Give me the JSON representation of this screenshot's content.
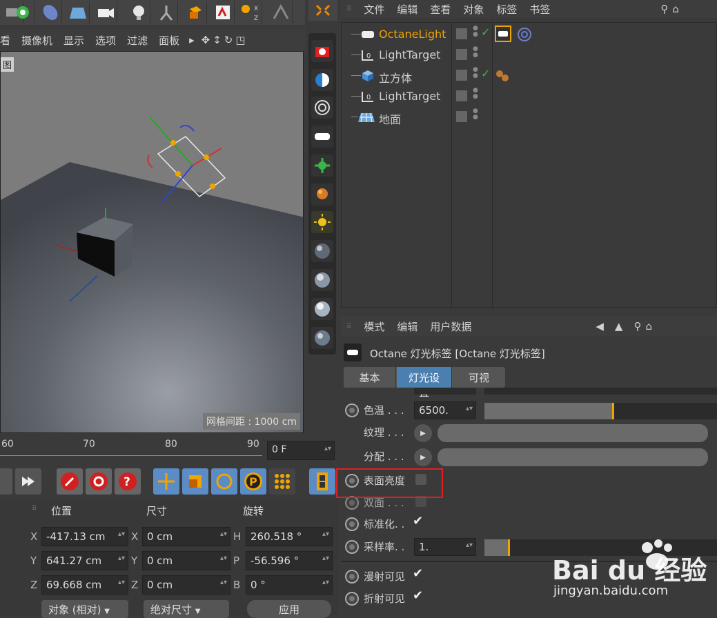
{
  "view_menu": [
    "看",
    "摄像机",
    "显示",
    "选项",
    "过滤",
    "面板"
  ],
  "viewport": {
    "label": "图",
    "grid_label": "网格间距 : 1000 cm"
  },
  "timeline": {
    "ticks": [
      "60",
      "70",
      "80",
      "90"
    ],
    "frame_value": "0 F"
  },
  "coords": {
    "headers": {
      "position": "位置",
      "size": "尺寸",
      "rotation": "旋转"
    },
    "rows": [
      {
        "axis": "X",
        "pos": "-417.13 cm",
        "size_axis": "X",
        "size": "0 cm",
        "rot_axis": "H",
        "rot": "260.518 °"
      },
      {
        "axis": "Y",
        "pos": "641.27 cm",
        "size_axis": "Y",
        "size": "0 cm",
        "rot_axis": "P",
        "rot": "-56.596 °"
      },
      {
        "axis": "Z",
        "pos": "69.668 cm",
        "size_axis": "Z",
        "size": "0 cm",
        "rot_axis": "B",
        "rot": "0 °"
      }
    ],
    "object_mode": "对象 (相对)",
    "size_mode": "绝对尺寸",
    "apply": "应用"
  },
  "object_manager": {
    "menu": [
      "文件",
      "编辑",
      "查看",
      "对象",
      "标签",
      "书签"
    ],
    "objects": [
      {
        "name": "OctaneLight",
        "active": true
      },
      {
        "name": "LightTarget",
        "active": false
      },
      {
        "name": "立方体",
        "active": false
      },
      {
        "name": "LightTarget",
        "active": false
      },
      {
        "name": "地面",
        "active": false
      }
    ]
  },
  "attributes": {
    "menu": [
      "模式",
      "编辑",
      "用户数据"
    ],
    "title": "Octane 灯光标签 [Octane 灯光标签]",
    "tabs": [
      "基本",
      "灯光设置",
      "可视"
    ],
    "active_tab": "灯光设置",
    "params": {
      "color_temp": {
        "label": "色温 . . .",
        "value": "6500.",
        "slider": 0.55
      },
      "texture": {
        "label": "纹理 . . ."
      },
      "distribution": {
        "label": "分配 . . ."
      },
      "surface_brightness": {
        "label": "表面亮度"
      },
      "double_sided": {
        "label": "双面 . . ."
      },
      "normalize": {
        "label": "标准化. ."
      },
      "sampling_rate": {
        "label": "采样率. .",
        "value": "1.",
        "slider": 0.1
      },
      "diffuse_visible": {
        "label": "漫射可见"
      },
      "refraction_visible": {
        "label": "折射可见"
      }
    }
  },
  "watermark": {
    "brand": "Bai du 经验",
    "url": "jingyan.baidu.com"
  },
  "colors": {
    "accent": "#f0a400",
    "highlight": "#e02020",
    "active_tab": "#4a7fb0"
  }
}
